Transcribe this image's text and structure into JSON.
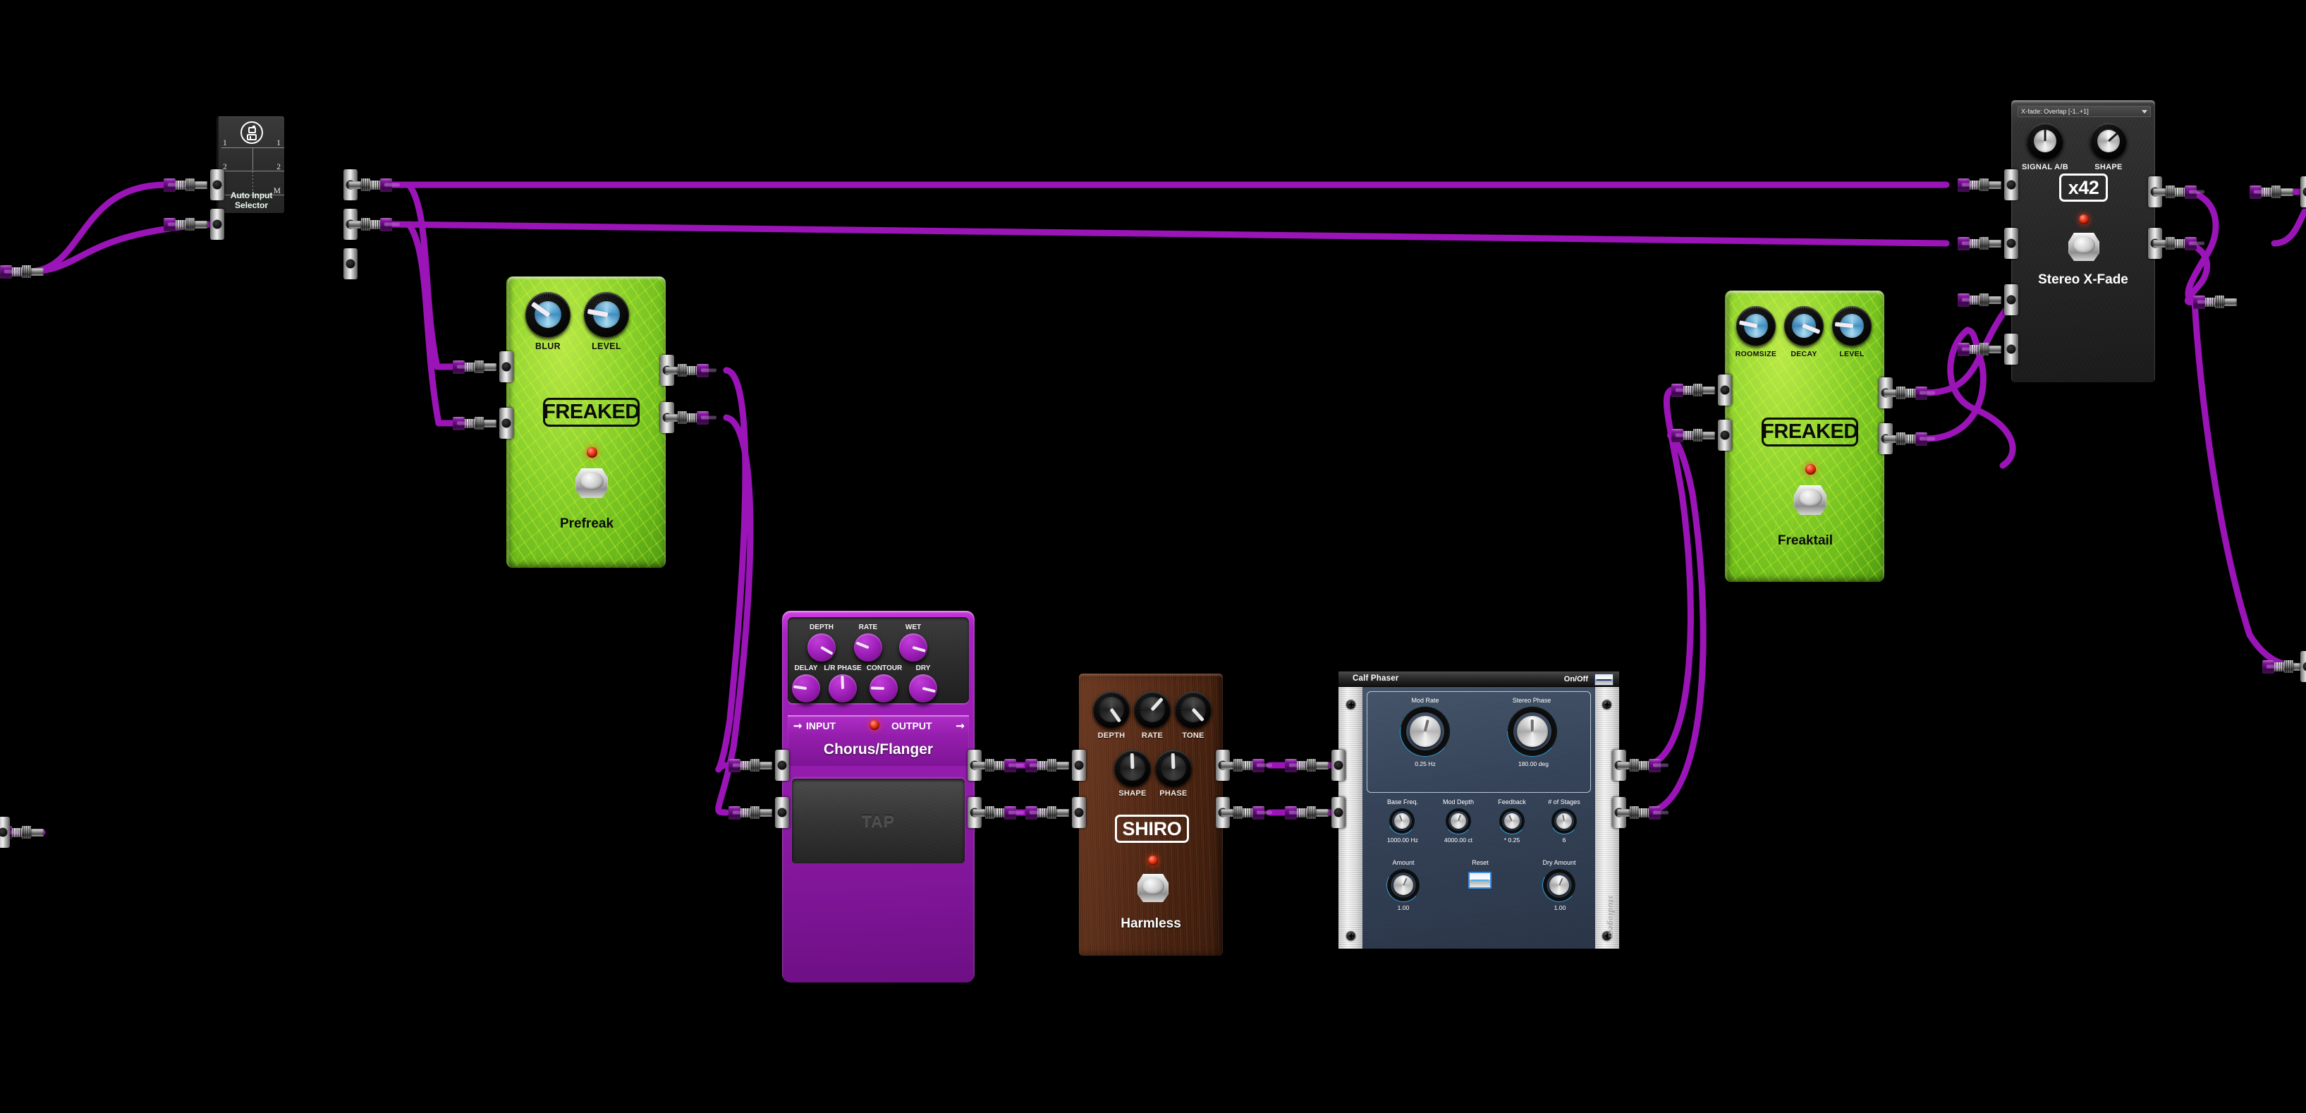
{
  "app": {
    "background_color": "#000000",
    "cable_color": "#9b14b8"
  },
  "devices": {
    "auto_input_selector": {
      "name": "Auto Input Selector",
      "icon": "auto-input-logo-icon",
      "row_labels_left": [
        "1",
        "2"
      ],
      "row_labels_right": [
        "1",
        "2",
        "M"
      ]
    },
    "prefreak": {
      "name": "Prefreak",
      "badge": "FREAKED",
      "knobs": [
        {
          "label": "BLUR",
          "angle": 35
        },
        {
          "label": "LEVEL",
          "angle": 168
        }
      ],
      "led": "on",
      "footswitch": "footswitch"
    },
    "chorus_flanger": {
      "name": "Chorus/Flanger",
      "input_label": "INPUT",
      "output_label": "OUTPUT",
      "tap_label": "TAP",
      "knobs_top": [
        {
          "label": "DEPTH",
          "angle": 48
        },
        {
          "label": "RATE",
          "angle": 208
        },
        {
          "label": "WET",
          "angle": 27
        }
      ],
      "knobs_bottom": [
        {
          "label": "DELAY",
          "angle": 196
        },
        {
          "label": "L/R PHASE",
          "angle": 270
        },
        {
          "label": "CONTOUR",
          "angle": 186
        },
        {
          "label": "DRY",
          "angle": 20
        }
      ],
      "led": "on"
    },
    "harmless": {
      "name": "Harmless",
      "badge": "SHIRO",
      "knobs_top": [
        {
          "label": "DEPTH",
          "angle": 60
        },
        {
          "label": "RATE",
          "angle": 320
        },
        {
          "label": "TONE",
          "angle": 52
        }
      ],
      "knobs_bottom": [
        {
          "label": "SHAPE",
          "angle": 270
        },
        {
          "label": "PHASE",
          "angle": 270
        }
      ],
      "led": "on"
    },
    "calf_phaser": {
      "title": "Calf Phaser",
      "onoff_label": "On/Off",
      "brand": "studiogear",
      "brand_mark": "Calf",
      "big_knobs": [
        {
          "label": "Mod Rate",
          "value": "0.25 Hz",
          "angle": 194
        },
        {
          "label": "Stereo Phase",
          "value": "180.00 deg",
          "angle": 180
        }
      ],
      "small_knobs": [
        {
          "label": "Base Freq.",
          "value": "1000.00 Hz",
          "angle": 160
        },
        {
          "label": "Mod Depth",
          "value": "4000.00 ct",
          "angle": 200
        },
        {
          "label": "Feedback",
          "value": "* 0.25",
          "angle": 155
        },
        {
          "label": "# of Stages",
          "value": "6",
          "angle": 170
        }
      ],
      "amount_knob": {
        "label": "Amount",
        "value": "1.00",
        "angle": 205
      },
      "dry_knob": {
        "label": "Dry Amount",
        "value": "1.00",
        "angle": 205
      },
      "reset_label": "Reset"
    },
    "freaktail": {
      "name": "Freaktail",
      "badge": "FREAKED",
      "knobs": [
        {
          "label": "ROOMSIZE",
          "angle": 196
        },
        {
          "label": "DECAY",
          "angle": 26
        },
        {
          "label": "LEVEL",
          "angle": 188
        }
      ],
      "led": "on",
      "footswitch": "footswitch"
    },
    "stereo_xfade": {
      "name": "Stereo X-Fade",
      "badge": "x42",
      "dropdown_value": "X-fade: Overlap [-1..+1]",
      "knobs": [
        {
          "label": "SIGNAL A/B",
          "angle": 180
        },
        {
          "label": "SHAPE",
          "angle": 228
        }
      ],
      "led": "on",
      "footswitch": "footswitch"
    }
  }
}
